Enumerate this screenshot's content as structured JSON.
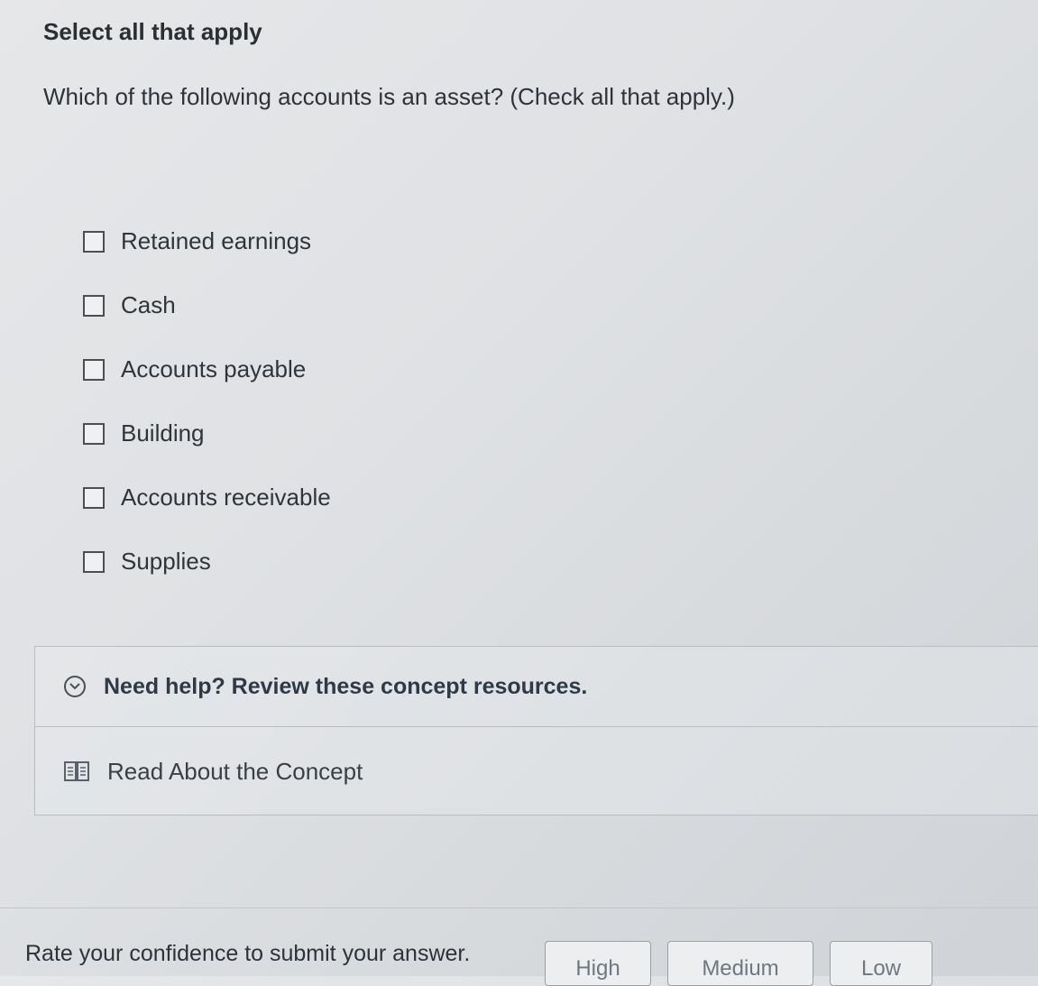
{
  "question": {
    "heading": "Select all that apply",
    "prompt": "Which of the following accounts is an asset? (Check all that apply.)"
  },
  "options": [
    {
      "label": "Retained earnings",
      "checked": false
    },
    {
      "label": "Cash",
      "checked": false
    },
    {
      "label": "Accounts payable",
      "checked": false
    },
    {
      "label": "Building",
      "checked": false
    },
    {
      "label": "Accounts receivable",
      "checked": false
    },
    {
      "label": "Supplies",
      "checked": false
    }
  ],
  "help": {
    "title": "Need help? Review these concept resources.",
    "link_label": "Read About the Concept",
    "expand_icon": "chevron-down-circle-icon",
    "link_icon": "book-icon"
  },
  "confidence": {
    "label": "Rate your confidence to submit your answer.",
    "buttons": [
      "High",
      "Medium",
      "Low"
    ]
  }
}
